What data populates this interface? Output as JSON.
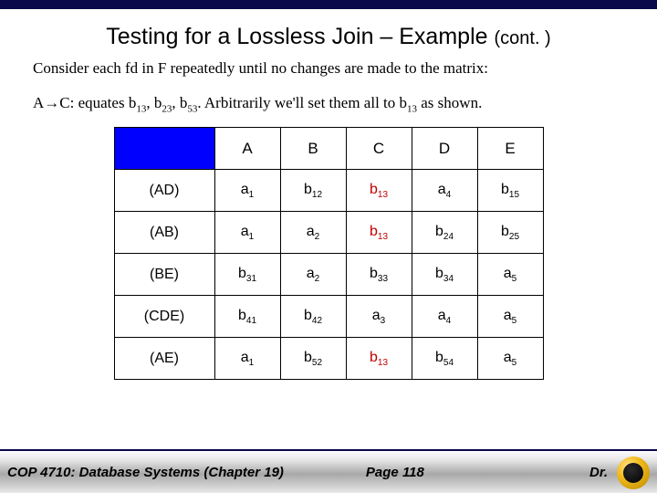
{
  "title_main": "Testing for a Lossless Join – Example",
  "title_cont": "(cont. )",
  "para1": "Consider each fd in F repeatedly until no changes are made to the matrix:",
  "para2_prefix": "A",
  "para2_arrow": "→",
  "para2_c": "C: equates b",
  "para2_s1": "13",
  "para2_comma1": ", b",
  "para2_s2": "23",
  "para2_comma2": ", b",
  "para2_s3": "53",
  "para2_rest": ".  Arbitrarily we'll set them all to b",
  "para2_s4": "13",
  "para2_end": " as shown.",
  "table": {
    "cols": [
      "A",
      "B",
      "C",
      "D",
      "E"
    ],
    "rows": [
      {
        "label": "(AD)",
        "cells": [
          {
            "m": "a",
            "s": "1"
          },
          {
            "m": "b",
            "s": "12"
          },
          {
            "m": "b",
            "s": "13",
            "red": true
          },
          {
            "m": "a",
            "s": "4"
          },
          {
            "m": "b",
            "s": "15"
          }
        ]
      },
      {
        "label": "(AB)",
        "cells": [
          {
            "m": "a",
            "s": "1"
          },
          {
            "m": "a",
            "s": "2"
          },
          {
            "m": "b",
            "s": "13",
            "red": true
          },
          {
            "m": "b",
            "s": "24"
          },
          {
            "m": "b",
            "s": "25"
          }
        ]
      },
      {
        "label": "(BE)",
        "cells": [
          {
            "m": "b",
            "s": "31"
          },
          {
            "m": "a",
            "s": "2"
          },
          {
            "m": "b",
            "s": "33"
          },
          {
            "m": "b",
            "s": "34"
          },
          {
            "m": "a",
            "s": "5"
          }
        ]
      },
      {
        "label": "(CDE)",
        "cells": [
          {
            "m": "b",
            "s": "41"
          },
          {
            "m": "b",
            "s": "42"
          },
          {
            "m": "a",
            "s": "3"
          },
          {
            "m": "a",
            "s": "4"
          },
          {
            "m": "a",
            "s": "5"
          }
        ]
      },
      {
        "label": "(AE)",
        "cells": [
          {
            "m": "a",
            "s": "1"
          },
          {
            "m": "b",
            "s": "52"
          },
          {
            "m": "b",
            "s": "13",
            "red": true
          },
          {
            "m": "b",
            "s": "54"
          },
          {
            "m": "a",
            "s": "5"
          }
        ]
      }
    ]
  },
  "footer": {
    "left": "COP 4710: Database Systems  (Chapter 19)",
    "mid": "Page 118",
    "right": "Dr."
  }
}
